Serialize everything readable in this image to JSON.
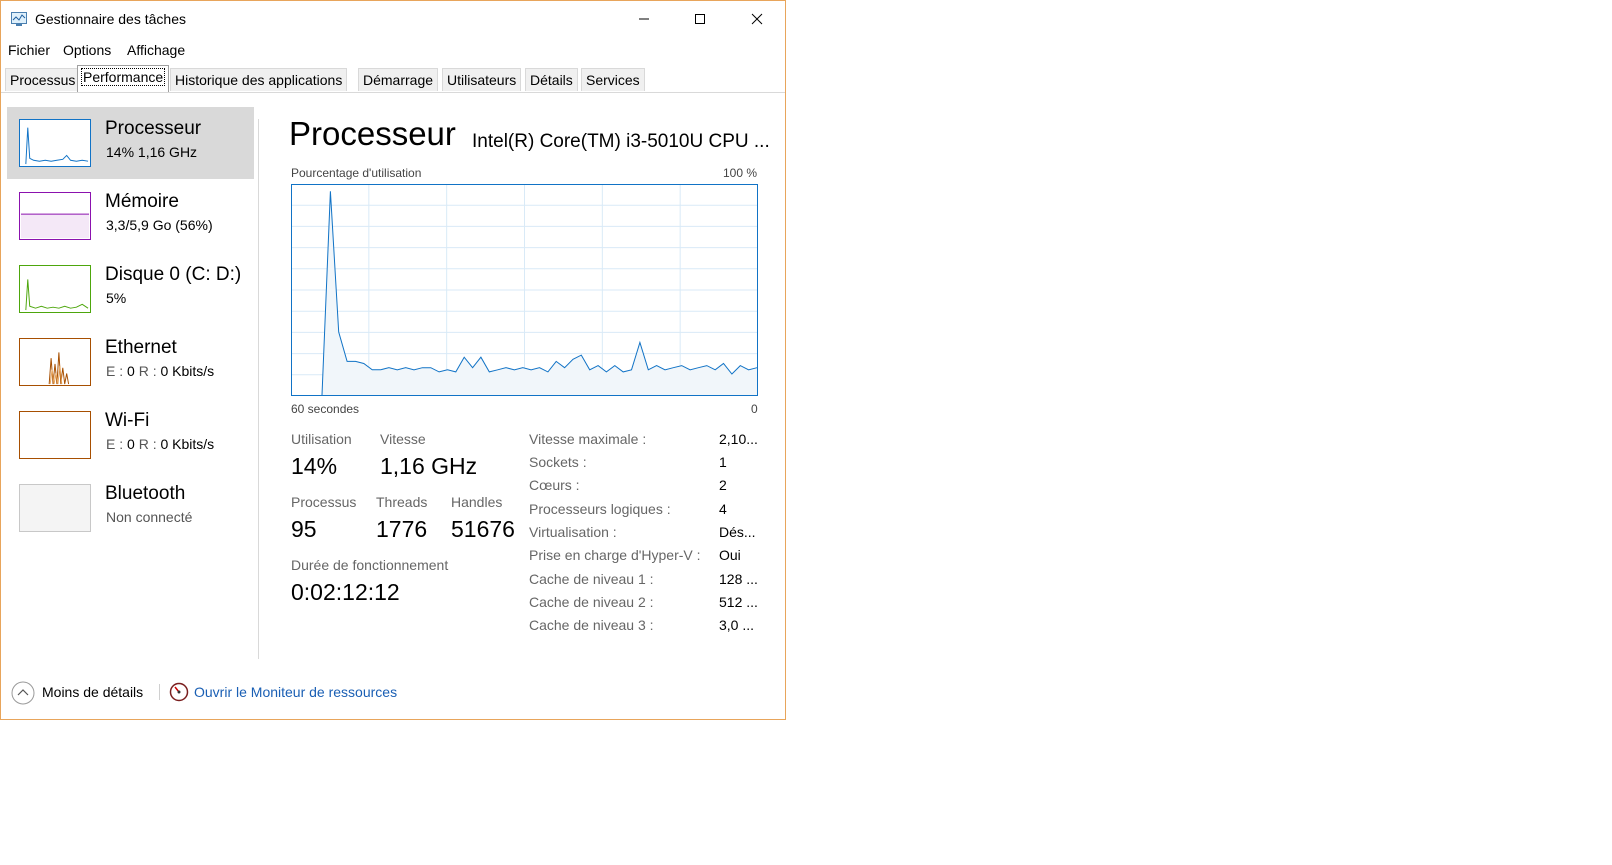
{
  "window": {
    "title": "Gestionnaire des tâches"
  },
  "menu": {
    "items": [
      "Fichier",
      "Options",
      "Affichage"
    ]
  },
  "tabs": [
    "Processus",
    "Performance",
    "Historique des applications",
    "Démarrage",
    "Utilisateurs",
    "Détails",
    "Services"
  ],
  "active_tab": "Performance",
  "sidebar": {
    "items": [
      {
        "title": "Processeur",
        "sub": "14%  1,16 GHz",
        "color": "#1173c6"
      },
      {
        "title": "Mémoire",
        "sub": "3,3/5,9 Go (56%)",
        "color": "#8b12ae"
      },
      {
        "title": "Disque 0 (C: D:)",
        "sub": "5%",
        "color": "#4da60c"
      },
      {
        "title": "Ethernet",
        "sub_prefix": "E :",
        "sub_mid": "0",
        "sub_r": "R :",
        "sub_rest": "0 Kbits/s",
        "color": "#a74f01"
      },
      {
        "title": "Wi-Fi",
        "sub_prefix": "E :",
        "sub_mid": "0",
        "sub_r": "R :",
        "sub_rest": "0 Kbits/s",
        "color": "#a74f01"
      },
      {
        "title": "Bluetooth",
        "sub": "Non connecté",
        "color": "#a0a0a0"
      }
    ]
  },
  "main": {
    "title": "Processeur",
    "cpu_name": "Intel(R) Core(TM) i3-5010U CPU ...",
    "graph_label_left": "Pourcentage d'utilisation",
    "graph_label_right": "100 %",
    "graph_time_left": "60 secondes",
    "graph_time_right": "0",
    "stats": {
      "utilisation_label": "Utilisation",
      "utilisation": "14%",
      "vitesse_label": "Vitesse",
      "vitesse": "1,16 GHz",
      "processus_label": "Processus",
      "processus": "95",
      "threads_label": "Threads",
      "threads": "1776",
      "handles_label": "Handles",
      "handles": "51676",
      "uptime_label": "Durée de fonctionnement",
      "uptime": "0:02:12:12"
    },
    "properties": [
      {
        "label": "Vitesse maximale :",
        "value": "2,10..."
      },
      {
        "label": "Sockets :",
        "value": "1"
      },
      {
        "label": "Cœurs :",
        "value": "2"
      },
      {
        "label": "Processeurs logiques :",
        "value": "4"
      },
      {
        "label": "Virtualisation :",
        "value": "Dés..."
      },
      {
        "label": "Prise en charge d'Hyper-V :",
        "value": "Oui"
      },
      {
        "label": "Cache de niveau 1 :",
        "value": "128 ..."
      },
      {
        "label": "Cache de niveau 2 :",
        "value": "512 ..."
      },
      {
        "label": "Cache de niveau 3 :",
        "value": "3,0 ..."
      }
    ]
  },
  "footer": {
    "less_details": "Moins de détails",
    "resource_monitor": "Ouvrir le Moniteur de ressources"
  },
  "chart_data": {
    "type": "area",
    "x_range": [
      60,
      0
    ],
    "ylim": [
      0,
      100
    ],
    "values": [
      0,
      97,
      30,
      16,
      16,
      15,
      12,
      12,
      13,
      12,
      13,
      12,
      13,
      13,
      11,
      12,
      11,
      18,
      13,
      18,
      11,
      12,
      13,
      12,
      13,
      12,
      13,
      11,
      16,
      13,
      17,
      19,
      12,
      14,
      11,
      14,
      11,
      12,
      25,
      12,
      14,
      12,
      13,
      14,
      12,
      13,
      14,
      12,
      15,
      10,
      14,
      12,
      13
    ]
  }
}
